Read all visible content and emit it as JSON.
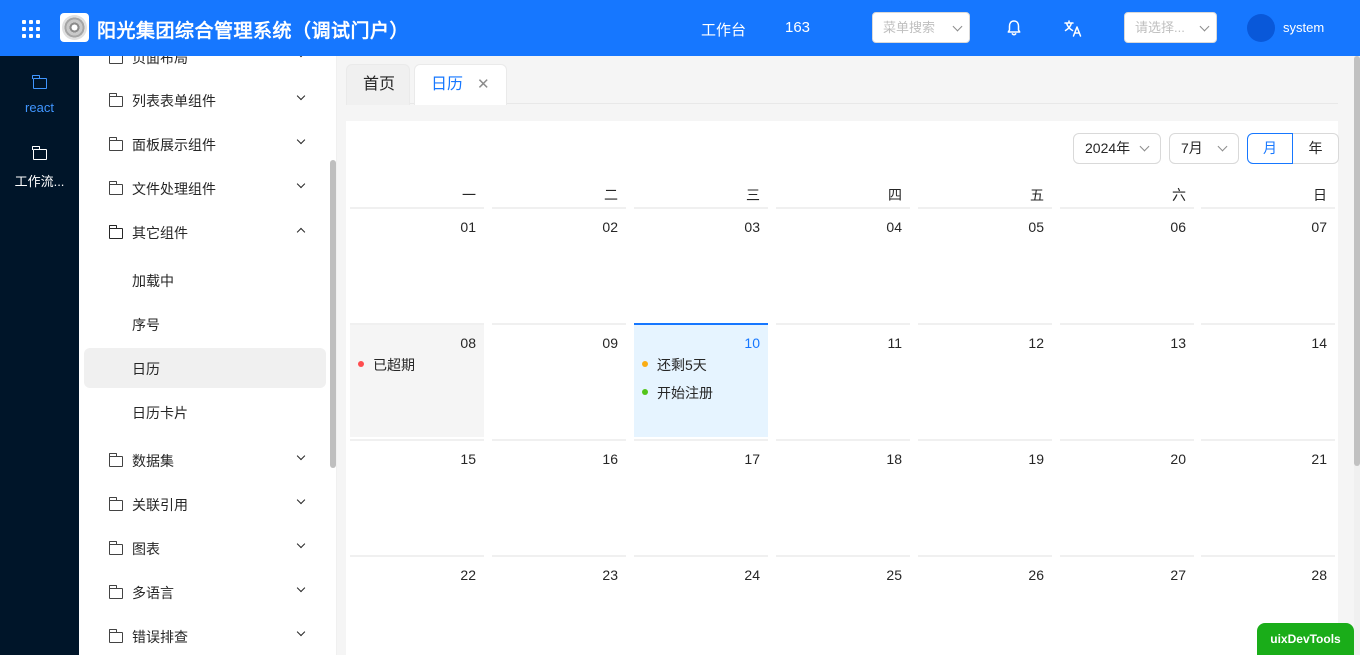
{
  "header": {
    "title": "阳光集团综合管理系统（调试门户）",
    "workbench": "工作台",
    "count": "163",
    "menu_search_placeholder": "菜单搜索",
    "org_select_placeholder": "请选择...",
    "user_name": "system",
    "icons": [
      "apps-grid-icon",
      "bell-icon",
      "translate-icon",
      "chevron-down-icon"
    ],
    "accent_color": "#1677ff"
  },
  "rail": {
    "items": [
      {
        "label": "react",
        "active": true
      },
      {
        "label": "工作流..."
      }
    ]
  },
  "sidebar": {
    "items": [
      {
        "label": "页面布局"
      },
      {
        "label": "列表表单组件"
      },
      {
        "label": "面板展示组件"
      },
      {
        "label": "文件处理组件"
      },
      {
        "label": "其它组件",
        "expanded": true
      },
      {
        "label": "数据集"
      },
      {
        "label": "关联引用"
      },
      {
        "label": "图表"
      },
      {
        "label": "多语言"
      },
      {
        "label": "错误排查"
      }
    ],
    "sub_items": [
      {
        "label": "加载中"
      },
      {
        "label": "序号"
      },
      {
        "label": "日历",
        "selected": true
      },
      {
        "label": "日历卡片"
      }
    ]
  },
  "tabs": [
    {
      "label": "首页"
    },
    {
      "label": "日历",
      "active": true,
      "close": "✕"
    }
  ],
  "calendar": {
    "year_select": "2024年",
    "month_select": "7月",
    "mode_month": "月",
    "mode_year": "年",
    "weekdays": [
      "一",
      "二",
      "三",
      "四",
      "五",
      "六",
      "日"
    ],
    "weeks": [
      [
        "01",
        "02",
        "03",
        "04",
        "05",
        "06",
        "07"
      ],
      [
        "08",
        "09",
        "10",
        "11",
        "12",
        "13",
        "14"
      ],
      [
        "15",
        "16",
        "17",
        "18",
        "19",
        "20",
        "21"
      ],
      [
        "22",
        "23",
        "24",
        "25",
        "26",
        "27",
        "28"
      ]
    ],
    "events": {
      "expired": {
        "label": "已超期",
        "color": "#ff4d4f"
      },
      "remaining": {
        "label": "还剩5天",
        "color": "#faad14"
      },
      "start": {
        "label": "开始注册",
        "color": "#52c41a"
      }
    }
  },
  "devtools": {
    "label": "uixDevTools"
  }
}
